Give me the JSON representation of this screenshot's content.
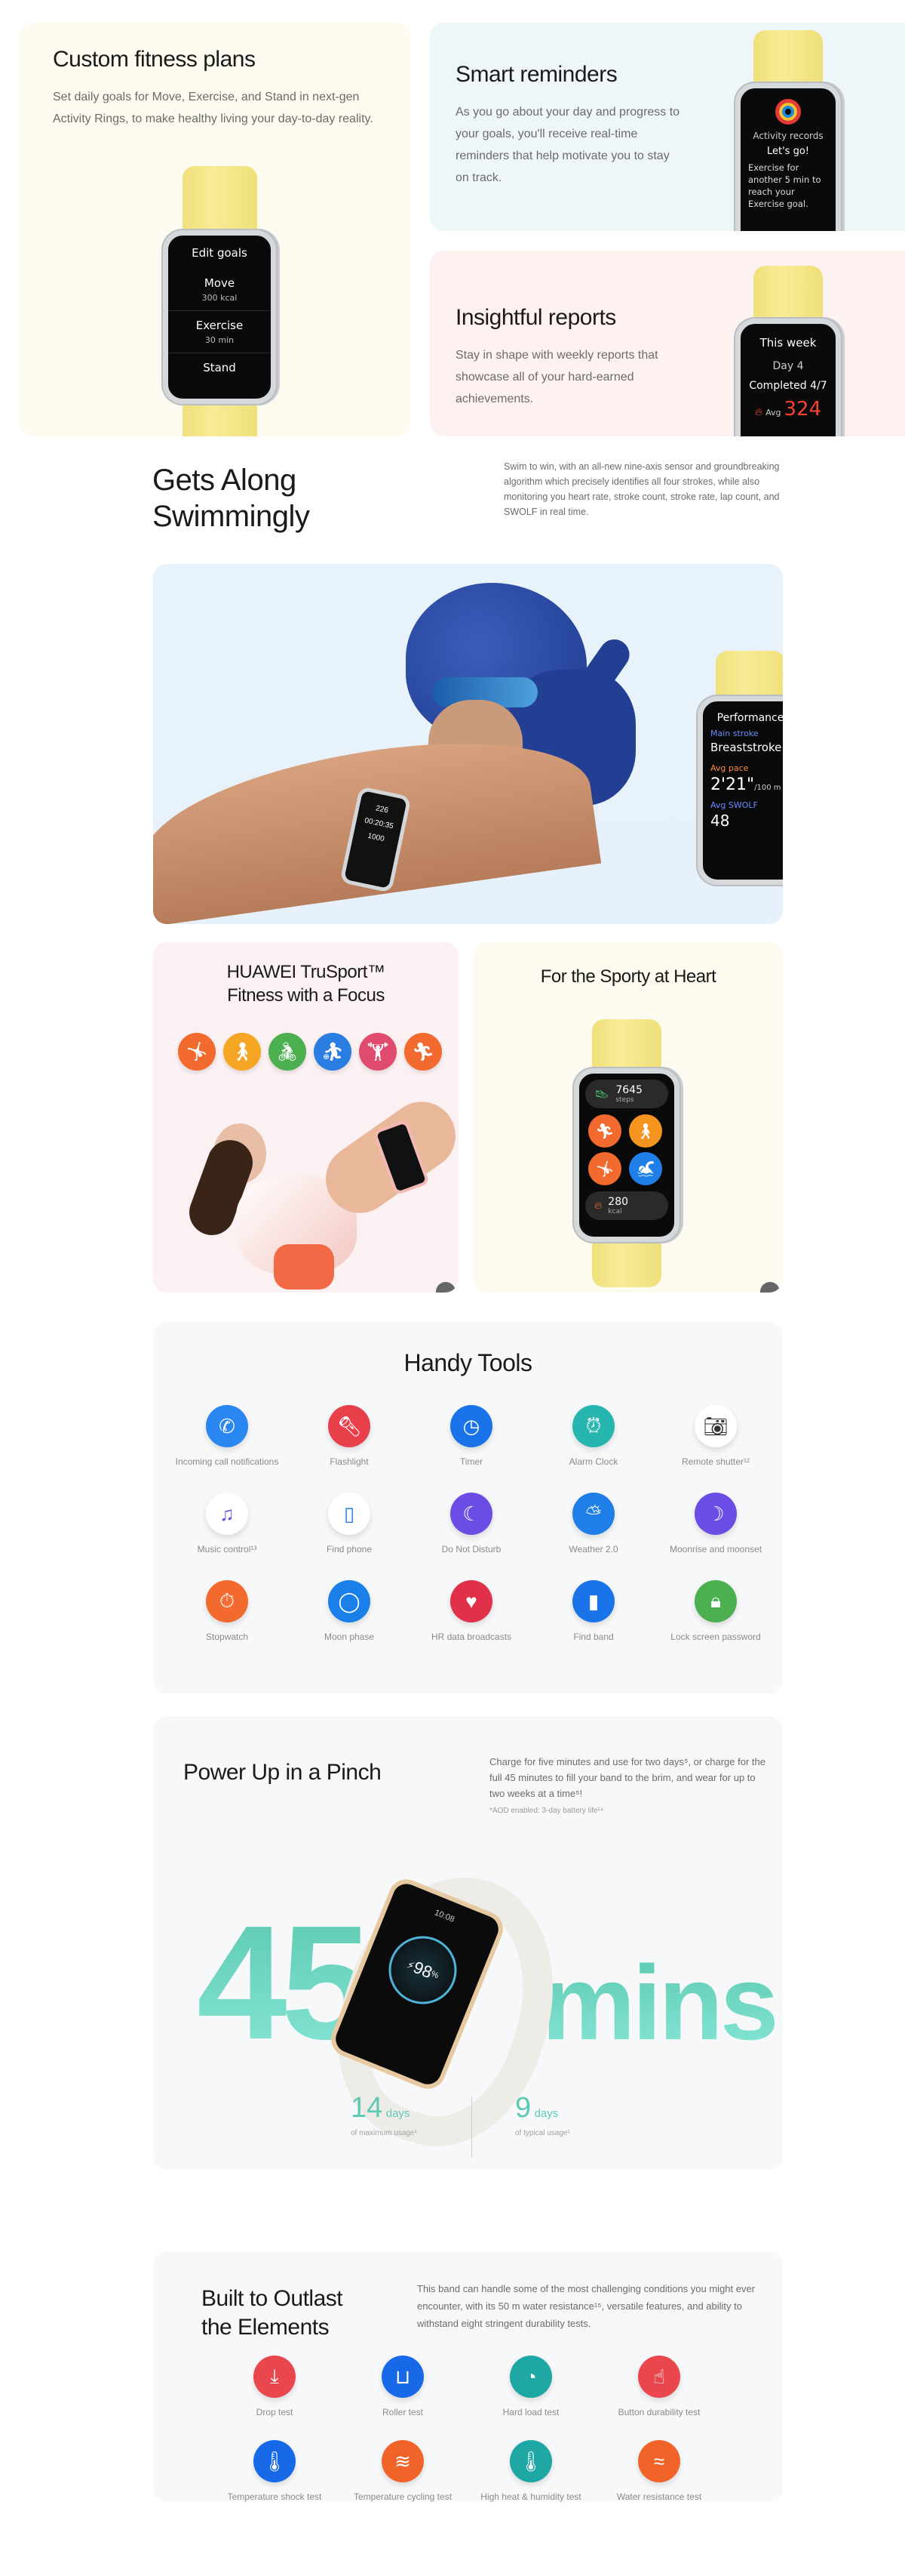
{
  "fitness_plans": {
    "title": "Custom fitness plans",
    "description": "Set daily goals for Move, Exercise, and Stand in next-gen Activity Rings, to make healthy living your day-to-day reality.",
    "screen": {
      "header": "Edit goals",
      "rows": [
        {
          "label": "Move",
          "value": "300 kcal"
        },
        {
          "label": "Exercise",
          "value": "30 min"
        },
        {
          "label": "Stand",
          "value": ""
        }
      ]
    }
  },
  "smart_reminders": {
    "title": "Smart reminders",
    "description": "As you go about your day and progress to your goals, you'll receive real-time reminders that help motivate you to stay on track.",
    "screen": {
      "header": "Activity records",
      "cheer": "Let's go!",
      "message": "Exercise for another 5 min to reach your Exercise goal."
    }
  },
  "insightful_reports": {
    "title": "Insightful reports",
    "description": "Stay in shape with weekly reports that showcase all of your hard-earned achievements.",
    "screen": {
      "header": "This week",
      "day": "Day 4",
      "completed": "Completed 4/7",
      "avg_label": "Avg",
      "avg_value": "324"
    }
  },
  "swimming": {
    "title_line1": "Gets Along",
    "title_line2": "Swimmingly",
    "description": "Swim to win, with an all-new nine-axis sensor and groundbreaking algorithm which precisely identifies all four strokes, while also monitoring you heart rate, stroke count, stroke rate, lap count, and SWOLF in real time.",
    "screen": {
      "header": "Performance",
      "stroke_label": "Main stroke",
      "stroke_value": "Breaststroke",
      "pace_label": "Avg pace",
      "pace_value": "2'21\"",
      "pace_unit": "/100 m",
      "swolf_label": "Avg SWOLF",
      "swolf_value": "48"
    },
    "wrist_screen": {
      "v1": "226",
      "v2": "00:20:35",
      "v3": "1000"
    }
  },
  "trusport": {
    "title_line1": "HUAWEI TruSport™",
    "title_line2": "Fitness with a Focus",
    "sport_icons": [
      {
        "icon": "jump-rope-icon",
        "color": "#f26a2e"
      },
      {
        "icon": "walking-icon",
        "color": "#f5a623"
      },
      {
        "icon": "cycling-icon",
        "color": "#4caf50"
      },
      {
        "icon": "elliptical-icon",
        "color": "#2a7de1"
      },
      {
        "icon": "weightlifting-icon",
        "color": "#e04a6e"
      },
      {
        "icon": "running-icon",
        "color": "#f26a2e"
      }
    ]
  },
  "sporty": {
    "title": "For the Sporty at Heart",
    "screen": {
      "steps_value": "7645",
      "steps_label": "steps",
      "kcal_value": "280",
      "kcal_label": "kcal"
    }
  },
  "handy_tools": {
    "title": "Handy Tools",
    "items": [
      {
        "label": "Incoming call notifications",
        "icon": "phone-icon",
        "color": "#2a86f0"
      },
      {
        "label": "Flashlight",
        "icon": "flashlight-icon",
        "color": "#e8404a"
      },
      {
        "label": "Timer",
        "icon": "timer-icon",
        "color": "#1a73e8"
      },
      {
        "label": "Alarm Clock",
        "icon": "alarm-clock-icon",
        "color": "#27b5b0"
      },
      {
        "label": "Remote shutter¹²",
        "icon": "camera-icon",
        "color": "#ffffff"
      },
      {
        "label": "Music control¹³",
        "icon": "music-icon",
        "color": "#ffffff"
      },
      {
        "label": "Find phone",
        "icon": "find-phone-icon",
        "color": "#ffffff"
      },
      {
        "label": "Do Not Disturb",
        "icon": "moon-icon",
        "color": "#6b4de6"
      },
      {
        "label": "Weather 2.0",
        "icon": "weather-icon",
        "color": "#1f7ee8"
      },
      {
        "label": "Moonrise and moonset",
        "icon": "moonrise-icon",
        "color": "#6b4de6"
      },
      {
        "label": "Stopwatch",
        "icon": "stopwatch-icon",
        "color": "#f26a2e"
      },
      {
        "label": "Moon phase",
        "icon": "moon-phase-icon",
        "color": "#1a7fe8"
      },
      {
        "label": "HR data broadcasts",
        "icon": "heart-broadcast-icon",
        "color": "#e0304a"
      },
      {
        "label": "Find band",
        "icon": "find-band-icon",
        "color": "#1a73e8"
      },
      {
        "label": "Lock screen password",
        "icon": "lock-icon",
        "color": "#4caf50"
      }
    ]
  },
  "power": {
    "title": "Power Up in a Pinch",
    "description": "Charge for five minutes and use for two days⁵, or charge for the full 45 minutes to fill your band to the brim, and wear for up to two weeks at a time⁵!",
    "note": "*AOD enabled: 3-day battery life¹⁴",
    "big_number": "45",
    "big_unit": "mins",
    "screen": {
      "time": "10:08",
      "battery": "98",
      "battery_unit": "%"
    },
    "stats": [
      {
        "value": "14",
        "unit": "days",
        "caption": "of maximum usage¹"
      },
      {
        "value": "9",
        "unit": "days",
        "caption": "of typical usage¹"
      }
    ],
    "accent": "#5fd3b5"
  },
  "durability": {
    "title_line1": "Built to Outlast",
    "title_line2": "the Elements",
    "description": "This band can handle some of the most challenging conditions you might ever encounter, with its 50 m water resistance¹⁵, versatile features, and ability to withstand eight stringent durability tests.",
    "tests": [
      {
        "label": "Drop test",
        "icon": "drop-test-icon",
        "color": "#e9464e"
      },
      {
        "label": "Roller test",
        "icon": "roller-test-icon",
        "color": "#1769e8"
      },
      {
        "label": "Hard load test",
        "icon": "gauge-icon",
        "color": "#1fa7a6"
      },
      {
        "label": "Button durability test",
        "icon": "button-press-icon",
        "color": "#e9464e"
      },
      {
        "label": "Temperature shock test",
        "icon": "thermometer-icon",
        "color": "#1769e8"
      },
      {
        "label": "Temperature cycling test",
        "icon": "wind-icon",
        "color": "#f0642a"
      },
      {
        "label": "High heat & humidity test",
        "icon": "humidity-thermometer-icon",
        "color": "#1fa7a6"
      },
      {
        "label": "Water resistance test",
        "icon": "water-icon",
        "color": "#f0642a"
      }
    ]
  }
}
